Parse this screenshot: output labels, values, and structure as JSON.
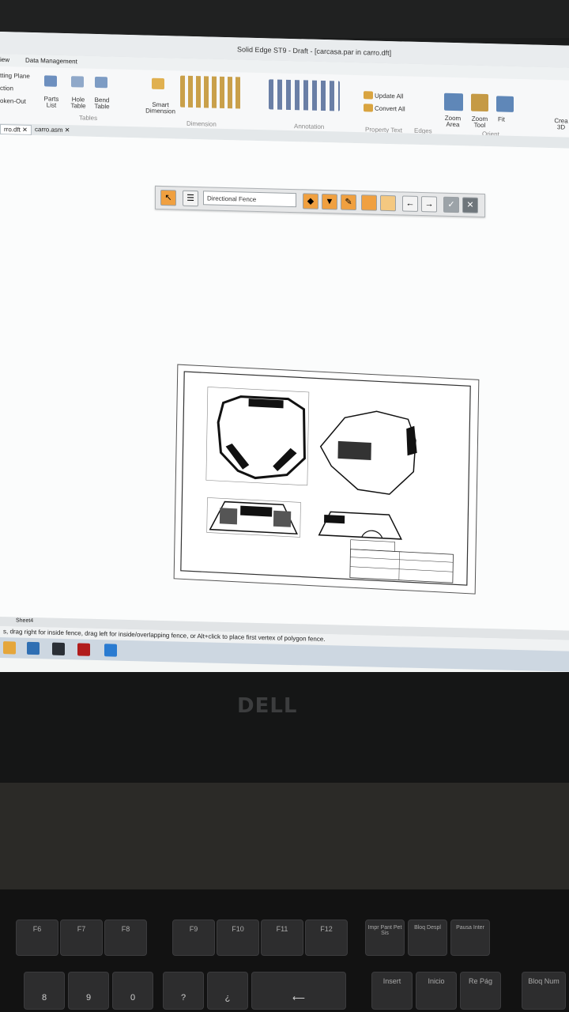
{
  "window": {
    "title": "Solid Edge ST9 - Draft - [carcasa.par in carro.dft]"
  },
  "menu": {
    "items": [
      "iew",
      "Data Management"
    ]
  },
  "ribbon": {
    "left_labels": [
      "tting Plane",
      "ction",
      "oken-Out"
    ],
    "tables": {
      "parts_list": "Parts List",
      "hole_table": "Hole Table",
      "bend_table": "Bend Table",
      "group": "Tables"
    },
    "dimension": {
      "smart_dimension": "Smart Dimension",
      "group": "Dimension"
    },
    "annotation": {
      "group": "Annotation"
    },
    "property_text": {
      "update_all": "Update All",
      "convert_all": "Convert All",
      "group": "Property Text",
      "edges": "Edges"
    },
    "orient": {
      "zoom_area": "Zoom Area",
      "zoom_tool": "Zoom Tool",
      "fit": "Fit",
      "group": "Orient",
      "create_3d": "Crea 3D"
    }
  },
  "doc_tabs": [
    {
      "label": "rro.dft"
    },
    {
      "label": "carro.asm"
    }
  ],
  "command_bar": {
    "fence_mode": "Directional Fence"
  },
  "sheet_tabs": {
    "active": "Sheet4"
  },
  "status_bar": {
    "message": "s, drag right for inside fence, drag left for inside/overlapping fence, or Alt+click to place first vertex of polygon fence."
  },
  "monitor": {
    "brand": "DELL"
  },
  "keyboard": {
    "fn_row": [
      "F6",
      "F7",
      "F8",
      "F9",
      "F10",
      "F11",
      "F12",
      "Impr Pant Pet Sis",
      "Bloq Despl",
      "Pausa Inter"
    ],
    "num_row": [
      "8",
      "9",
      "0",
      "?",
      "¿",
      "Insert",
      "Inicio",
      "Re Pág",
      "Bloq Num"
    ]
  },
  "colors": {
    "accent_orange": "#f0a040",
    "taskbar": "#cdd7e1"
  }
}
